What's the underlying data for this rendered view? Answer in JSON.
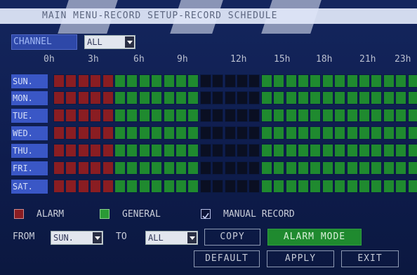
{
  "title": "MAIN MENU-RECORD SETUP-RECORD SCHEDULE",
  "channel": {
    "label": "CHANNEL",
    "value": "ALL"
  },
  "hour_labels": [
    "0h",
    "3h",
    "6h",
    "9h",
    "12h",
    "15h",
    "18h",
    "21h",
    "23h"
  ],
  "days": [
    "SUN.",
    "MON.",
    "TUE.",
    "WED.",
    "THU.",
    "FRI.",
    "SAT."
  ],
  "schedule_key": {
    "A": "alarm",
    "G": "general",
    "N": "none"
  },
  "schedule": [
    "AAAAAGGGGGGGNNNNNGGGGGGGGGGGGGGG",
    "AAAAAGGGGGGGNNNNNGGGGGGGGGGGGGGG",
    "AAAAAGGGGGGGNNNNNGGGGGGGGGGGGGGG",
    "AAAAAGGGGGGGNNNNNGGGGGGGGGGGGGGG",
    "AAAAAGGGGGGGNNNNNGGGGGGGGGGGGGGG",
    "AAAAAGGGGGGGNNNNNGGGGGGGGGGGGGGG",
    "AAAAAGGGGGGGNNNNNGGGGGGGGGGGGGGG"
  ],
  "legend": {
    "alarm": "ALARM",
    "general": "GENERAL",
    "manual": "MANUAL RECORD",
    "manual_checked": true
  },
  "copy_row": {
    "from_label": "FROM",
    "from_value": "SUN.",
    "to_label": "TO",
    "to_value": "ALL",
    "copy_label": "COPY",
    "alarm_mode_label": "ALARM MODE"
  },
  "buttons": {
    "default": "DEFAULT",
    "apply": "APPLY",
    "exit": "EXIT"
  },
  "colors": {
    "alarm": "#8a1d22",
    "general": "#1f8a2f",
    "none": "#0a0f22",
    "header": "#3a57c6",
    "background": "#14265e"
  }
}
